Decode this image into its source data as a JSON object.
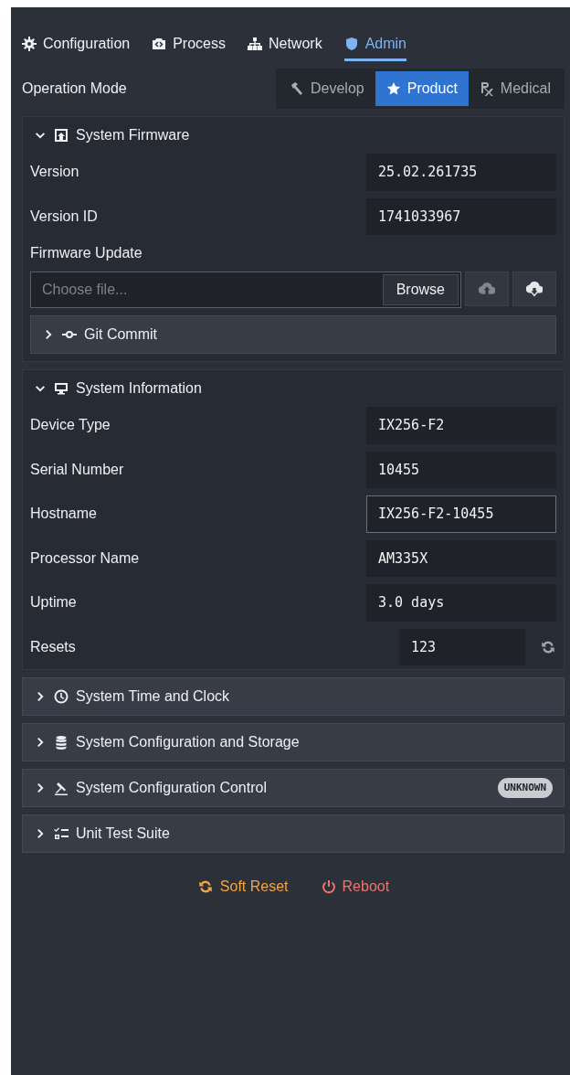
{
  "tabs": [
    {
      "label": "Configuration",
      "selected": false
    },
    {
      "label": "Process",
      "selected": false
    },
    {
      "label": "Network",
      "selected": false
    },
    {
      "label": "Admin",
      "selected": true
    }
  ],
  "operation_mode": {
    "label": "Operation Mode",
    "options": [
      {
        "label": "Develop",
        "selected": false
      },
      {
        "label": "Product",
        "selected": true
      },
      {
        "label": "Medical",
        "selected": false
      }
    ]
  },
  "sections": [
    {
      "title": "System Firmware",
      "expanded": true,
      "fields": [
        {
          "kind": "readonly",
          "label": "Version",
          "value": "25.02.261735"
        },
        {
          "kind": "readonly",
          "label": "Version ID",
          "value": "1741033967"
        }
      ],
      "firmware_update": {
        "label": "Firmware Update",
        "placeholder": "Choose file...",
        "browse": "Browse"
      },
      "subsections": [
        {
          "title": "Git Commit",
          "expanded": false
        }
      ]
    },
    {
      "title": "System Information",
      "expanded": true,
      "fields": [
        {
          "kind": "readonly",
          "label": "Device Type",
          "value": "IX256-F2"
        },
        {
          "kind": "readonly",
          "label": "Serial Number",
          "value": "10455"
        },
        {
          "kind": "input",
          "label": "Hostname",
          "value": "IX256-F2-10455"
        },
        {
          "kind": "readonly",
          "label": "Processor Name",
          "value": "AM335X"
        },
        {
          "kind": "readonly",
          "label": "Uptime",
          "value": "3.0 days"
        },
        {
          "kind": "refresh",
          "label": "Resets",
          "value": "123"
        }
      ]
    },
    {
      "title": "System Time and Clock",
      "expanded": false
    },
    {
      "title": "System Configuration and Storage",
      "expanded": false
    },
    {
      "title": "System Configuration Control",
      "expanded": false,
      "badge": "UNKNOWN"
    },
    {
      "title": "Unit Test Suite",
      "expanded": false
    }
  ],
  "actions": [
    {
      "kind": "warning",
      "label": "Soft Reset"
    },
    {
      "kind": "danger",
      "label": "Reboot"
    }
  ]
}
